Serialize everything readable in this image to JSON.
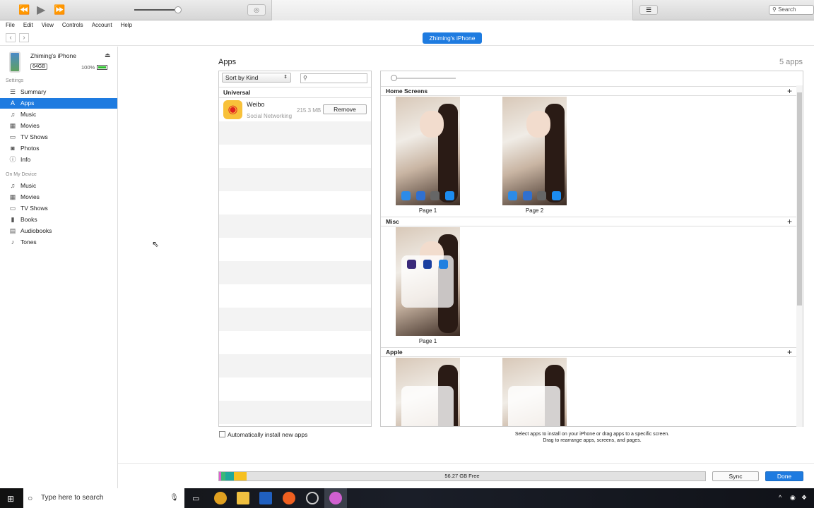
{
  "window": {
    "search_placeholder": "Search",
    "apple_logo": "apple-logo"
  },
  "menu": [
    "File",
    "Edit",
    "View",
    "Controls",
    "Account",
    "Help"
  ],
  "device_tab": "Zhiming's iPhone",
  "device": {
    "name": "Zhiming's iPhone",
    "capacity": "64GB",
    "battery": "100%"
  },
  "sidebar": {
    "settings_header": "Settings",
    "settings": [
      {
        "label": "Summary",
        "icon": "list-icon"
      },
      {
        "label": "Apps",
        "icon": "apps-icon"
      },
      {
        "label": "Music",
        "icon": "music-note-icon"
      },
      {
        "label": "Movies",
        "icon": "film-icon"
      },
      {
        "label": "TV Shows",
        "icon": "tv-icon"
      },
      {
        "label": "Photos",
        "icon": "camera-icon"
      },
      {
        "label": "Info",
        "icon": "info-icon"
      }
    ],
    "device_header": "On My Device",
    "device_items": [
      {
        "label": "Music",
        "icon": "music-note-icon"
      },
      {
        "label": "Movies",
        "icon": "film-icon"
      },
      {
        "label": "TV Shows",
        "icon": "tv-icon"
      },
      {
        "label": "Books",
        "icon": "book-icon"
      },
      {
        "label": "Audiobooks",
        "icon": "audiobook-icon"
      },
      {
        "label": "Tones",
        "icon": "bell-icon"
      }
    ]
  },
  "apps": {
    "title": "Apps",
    "count": "5 apps",
    "sort": "Sort by Kind",
    "search_value": "",
    "group": "Universal",
    "list": [
      {
        "name": "Weibo",
        "category": "Social Networking",
        "size": "215.3 MB",
        "action": "Remove"
      }
    ],
    "auto_install": "Automatically install new apps",
    "auto_install_checked": false
  },
  "screens": {
    "sections": [
      {
        "title": "Home Screens",
        "pages": [
          "Page 1",
          "Page 2"
        ]
      },
      {
        "title": "Misc",
        "pages": [
          "Page 1"
        ]
      },
      {
        "title": "Apple",
        "pages": []
      }
    ],
    "hint1": "Select apps to install on your iPhone or drag apps to a specific screen.",
    "hint2": "Drag to rearrange apps, screens, and pages."
  },
  "storage": {
    "free": "56.27 GB Free",
    "colors": [
      "#e060d0",
      "#3cb878",
      "#20a89a",
      "#f6c020"
    ]
  },
  "buttons": {
    "sync": "Sync",
    "done": "Done"
  },
  "taskbar": {
    "search_placeholder": "Type here to search"
  },
  "accent": "#1e7be0"
}
